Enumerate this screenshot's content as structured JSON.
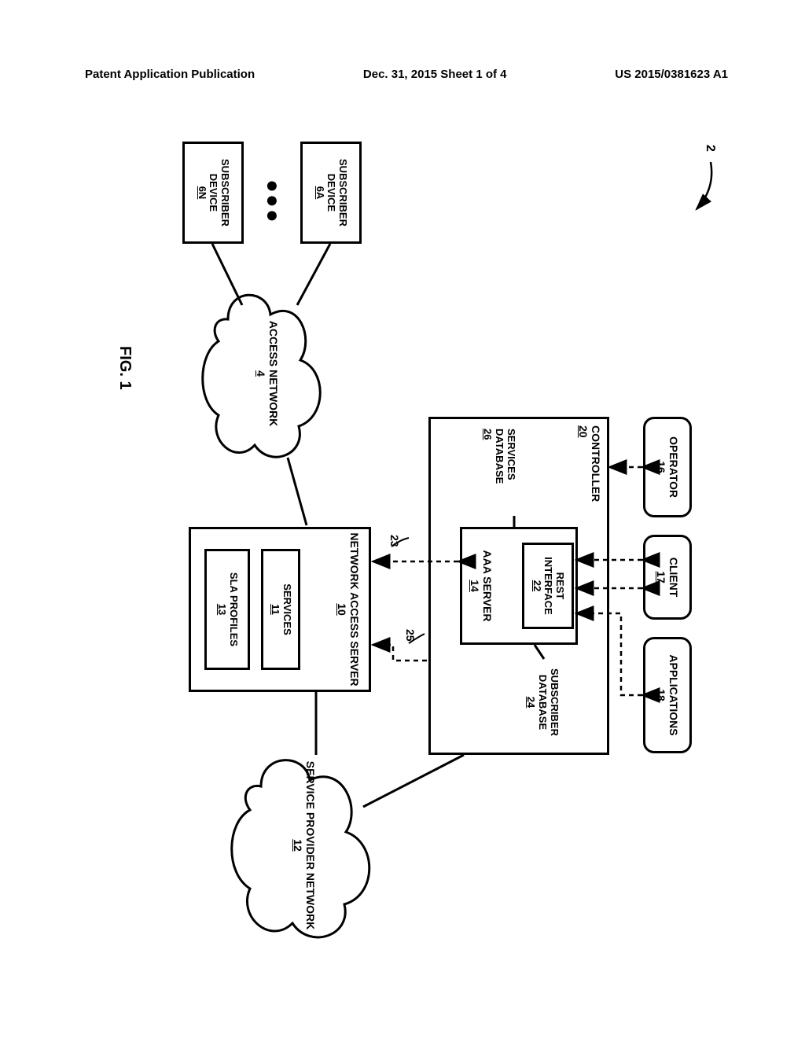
{
  "header": {
    "left": "Patent Application Publication",
    "mid": "Dec. 31, 2015  Sheet 1 of 4",
    "right": "US 2015/0381623 A1"
  },
  "fig_label": "FIG. 1",
  "system_ref": "2",
  "boxes": {
    "operator": {
      "title": "OPERATOR",
      "ref": "16"
    },
    "client": {
      "title": "CLIENT",
      "ref": "17"
    },
    "applications": {
      "title": "APPLICATIONS",
      "ref": "18"
    },
    "controller_label": {
      "title": "CONTROLLER",
      "ref": "20"
    },
    "rest": {
      "title": "REST INTERFACE",
      "ref": "22"
    },
    "aaa": {
      "title": "AAA SERVER",
      "ref": "14"
    },
    "nas": {
      "title": "NETWORK ACCESS SERVER",
      "ref": "10"
    },
    "services": {
      "title": "SERVICES",
      "ref": "11"
    },
    "sla": {
      "title": "SLA PROFILES",
      "ref": "13"
    },
    "sub_a": {
      "title": "SUBSCRIBER DEVICE",
      "ref": "6A"
    },
    "sub_n": {
      "title": "SUBSCRIBER DEVICE",
      "ref": "6N"
    }
  },
  "clouds": {
    "access": {
      "title": "ACCESS NETWORK",
      "ref": "4"
    },
    "sp": {
      "title": "SERVICE PROVIDER NETWORK",
      "ref": "12"
    }
  },
  "dbs": {
    "services_db": {
      "title": "SERVICES DATABASE",
      "ref": "26"
    },
    "sub_db": {
      "title": "SUBSCRIBER DATABASE",
      "ref": "24"
    }
  },
  "link_refs": {
    "l23": "23",
    "l25": "25"
  }
}
